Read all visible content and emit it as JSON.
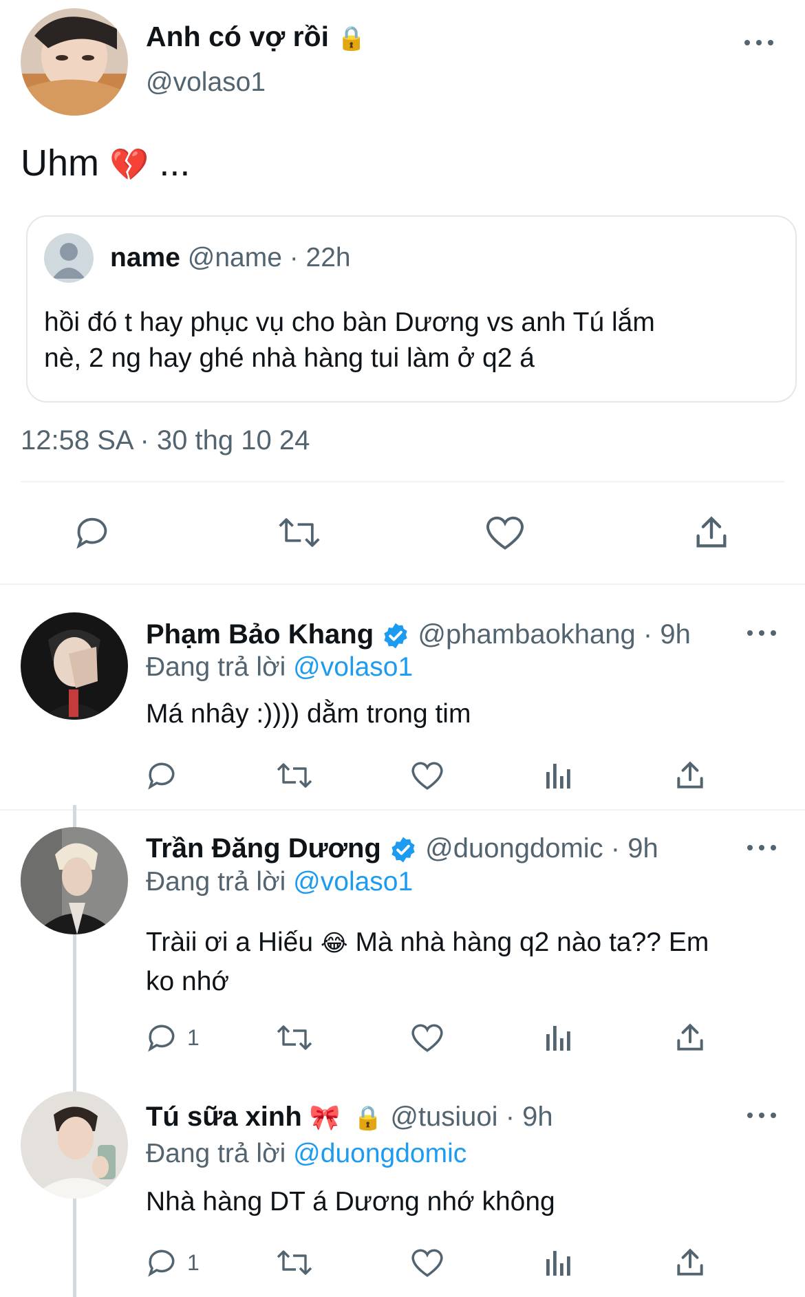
{
  "main_tweet": {
    "author_name": "Anh có vợ rồi",
    "lock_emoji": "🔒",
    "handle": "@volaso1",
    "text": "Uhm",
    "emoji": "💔",
    "ellipsis": "...",
    "quote": {
      "author_name": "name",
      "handle": "@name",
      "time": "· 22h",
      "text_line1": "hồi đó t hay phục vụ cho bàn Dương vs anh Tú lắm",
      "text_line2": "nè, 2 ng hay ghé nhà hàng tui làm ở q2 á"
    },
    "timestamp": "12:58 SA · 30 thg 10 24",
    "actions": [
      "reply-icon",
      "retweet-icon",
      "like-icon",
      "share-icon"
    ]
  },
  "replies": [
    {
      "author_name": "Phạm Bảo Khang",
      "handle": "@phambaokhang",
      "time": "· 9h",
      "verified": true,
      "replying_prefix": "Đang trả lời",
      "replying_to": "@volaso1",
      "text": "Má nhây :)))) dằm trong tim",
      "reply_count": ""
    },
    {
      "author_name": "Trần Đăng Dương",
      "handle": "@duongdomic",
      "time": "· 9h",
      "verified": true,
      "replying_prefix": "Đang trả lời",
      "replying_to": "@volaso1",
      "text_line1": "Tràii ơi a Hiếu",
      "emoji": "😂",
      "text_line1b": "Mà nhà hàng q2 nào ta?? Em",
      "text_line2": "ko nhớ",
      "reply_count": "1"
    },
    {
      "author_name": "Tú sữa xinh",
      "ribbon_emoji": "🎀",
      "lock_emoji": "🔒",
      "handle": "@tusiuoi",
      "time": "· 9h",
      "replying_prefix": "Đang trả lời",
      "replying_to": "@duongdomic",
      "text": "Nhà hàng DT á Dương nhớ không",
      "reply_count": "1"
    }
  ],
  "colors": {
    "accent": "#1d9bf0",
    "secondary_text": "#536471",
    "divider": "#eff3f4",
    "text": "#0f1419"
  }
}
